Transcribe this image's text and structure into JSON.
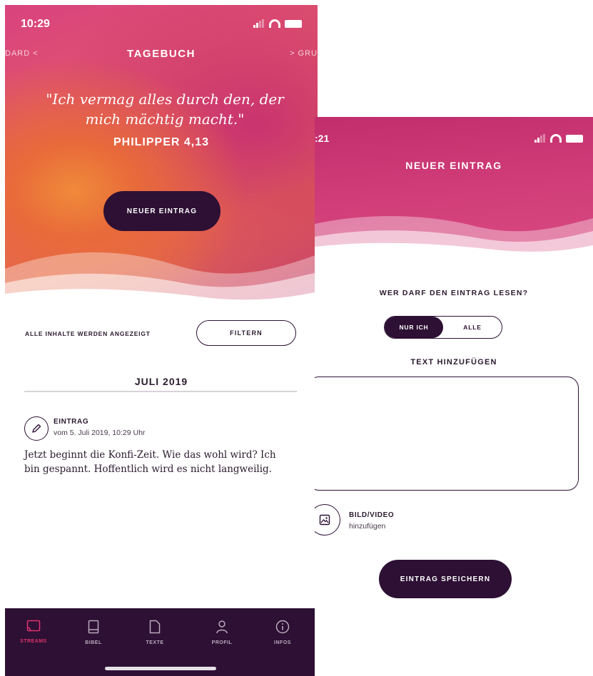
{
  "left": {
    "status": {
      "time": "10:29"
    },
    "nav": {
      "prev": "DARD <",
      "title": "TAGEBUCH",
      "next": "> GRU"
    },
    "quote": {
      "text": "\"Ich vermag alles durch den, der mich mächtig macht.\"",
      "reference": "PHILIPPER 4,13"
    },
    "new_entry_button": "NEUER EINTRAG",
    "filter": {
      "status": "ALLE INHALTE WERDEN ANGEZEIGT",
      "button": "FILTERN"
    },
    "month": "JULI 2019",
    "entry": {
      "type": "EINTRAG",
      "date": "vom 5. Juli 2019, 10:29 Uhr",
      "text": "Jetzt beginnt die Konfi-Zeit. Wie das wohl wird? Ich bin gespannt. Hoffentlich wird es nicht langweilig."
    },
    "tabs": [
      {
        "label": "STREAMS",
        "icon": "cast-icon",
        "active": true
      },
      {
        "label": "BIBEL",
        "icon": "book-icon",
        "active": false
      },
      {
        "label": "TEXTE",
        "icon": "document-icon",
        "active": false
      },
      {
        "label": "PROFIL",
        "icon": "user-icon",
        "active": false
      },
      {
        "label": "INFOS",
        "icon": "info-icon",
        "active": false
      }
    ]
  },
  "right": {
    "status": {
      "time": ":21"
    },
    "title": "NEUER EINTRAG",
    "visibility": {
      "label": "WER DARF DEN EINTRAG LESEN?",
      "options": [
        "NUR ICH",
        "ALLE"
      ],
      "selected": "NUR ICH"
    },
    "text_label": "TEXT HINZUFÜGEN",
    "media": {
      "title": "BILD/VIDEO",
      "subtitle": "hinzufügen"
    },
    "save_button": "EINTRAG SPEICHERN"
  },
  "colors": {
    "dark": "#2d1034",
    "accent": "#e0336f",
    "hero_pink": "#d9437e",
    "hero_orange": "#e86a3a"
  }
}
